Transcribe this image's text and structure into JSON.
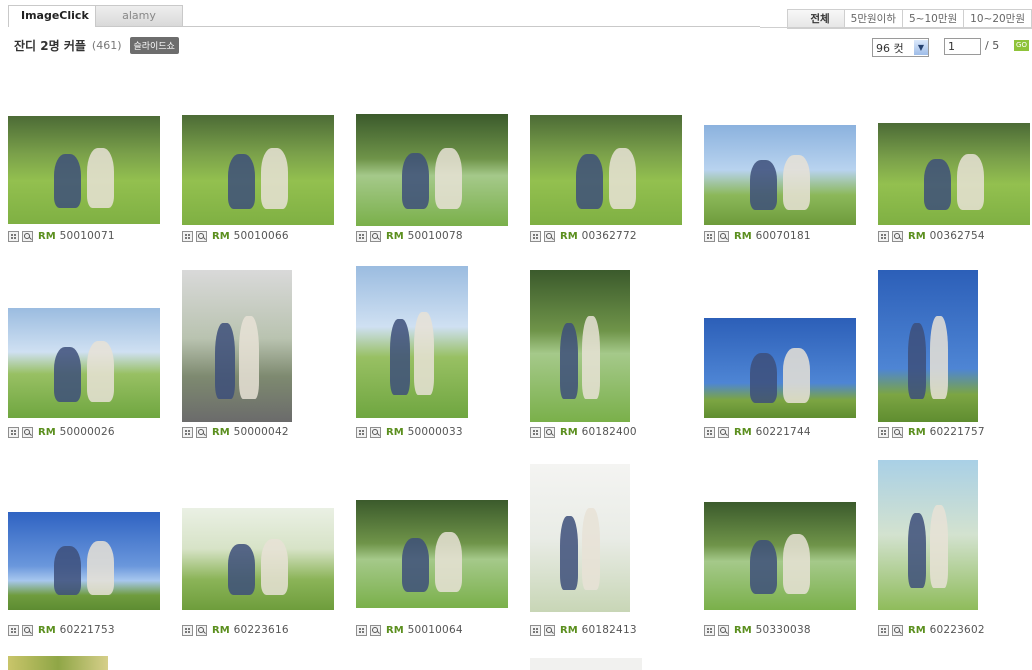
{
  "tabs": [
    {
      "label": "ImageClick",
      "active": true
    },
    {
      "label": "alamy",
      "active": false
    }
  ],
  "price_filters": [
    {
      "label": "전체",
      "active": true
    },
    {
      "label": "5만원이하",
      "active": false
    },
    {
      "label": "5~10만원",
      "active": false
    },
    {
      "label": "10~20만원",
      "active": false
    }
  ],
  "album": {
    "title": "잔디 2명 커플",
    "count": "(461)",
    "slideshow_label": "슬라이드쇼"
  },
  "paging": {
    "per_page": "96 컷",
    "current_page": "1",
    "total": "/ 5",
    "go_label": "GO"
  },
  "colors": {
    "rm_green": "#5b8f1e",
    "go_green": "#8fc33a",
    "tab_border": "#c9c9c9"
  },
  "icons": {
    "lightbox": "lightbox-icon",
    "zoom": "zoom-icon"
  },
  "items": [
    {
      "rm": "RM",
      "code": "50010071",
      "style": "ph-grass"
    },
    {
      "rm": "RM",
      "code": "50010066",
      "style": "ph-grass"
    },
    {
      "rm": "RM",
      "code": "50010078",
      "style": "ph-park"
    },
    {
      "rm": "RM",
      "code": "00362772",
      "style": "ph-grass"
    },
    {
      "rm": "RM",
      "code": "60070181",
      "style": "ph-bluegreen"
    },
    {
      "rm": "RM",
      "code": "00362754",
      "style": "ph-grass"
    },
    {
      "rm": "RM",
      "code": "50000026",
      "style": "ph-city"
    },
    {
      "rm": "RM",
      "code": "50000042",
      "style": "ph-road"
    },
    {
      "rm": "RM",
      "code": "50000033",
      "style": "ph-city"
    },
    {
      "rm": "RM",
      "code": "60182400",
      "style": "ph-park"
    },
    {
      "rm": "RM",
      "code": "60221744",
      "style": "ph-tilt"
    },
    {
      "rm": "RM",
      "code": "60221757",
      "style": "ph-tilt"
    },
    {
      "rm": "RM",
      "code": "60221753",
      "style": "ph-sky"
    },
    {
      "rm": "RM",
      "code": "60223616",
      "style": "ph-warm"
    },
    {
      "rm": "RM",
      "code": "50010064",
      "style": "ph-park"
    },
    {
      "rm": "RM",
      "code": "60182413",
      "style": "ph-white"
    },
    {
      "rm": "RM",
      "code": "50330038",
      "style": "ph-park"
    },
    {
      "rm": "RM",
      "code": "60223602",
      "style": "ph-girl"
    }
  ]
}
